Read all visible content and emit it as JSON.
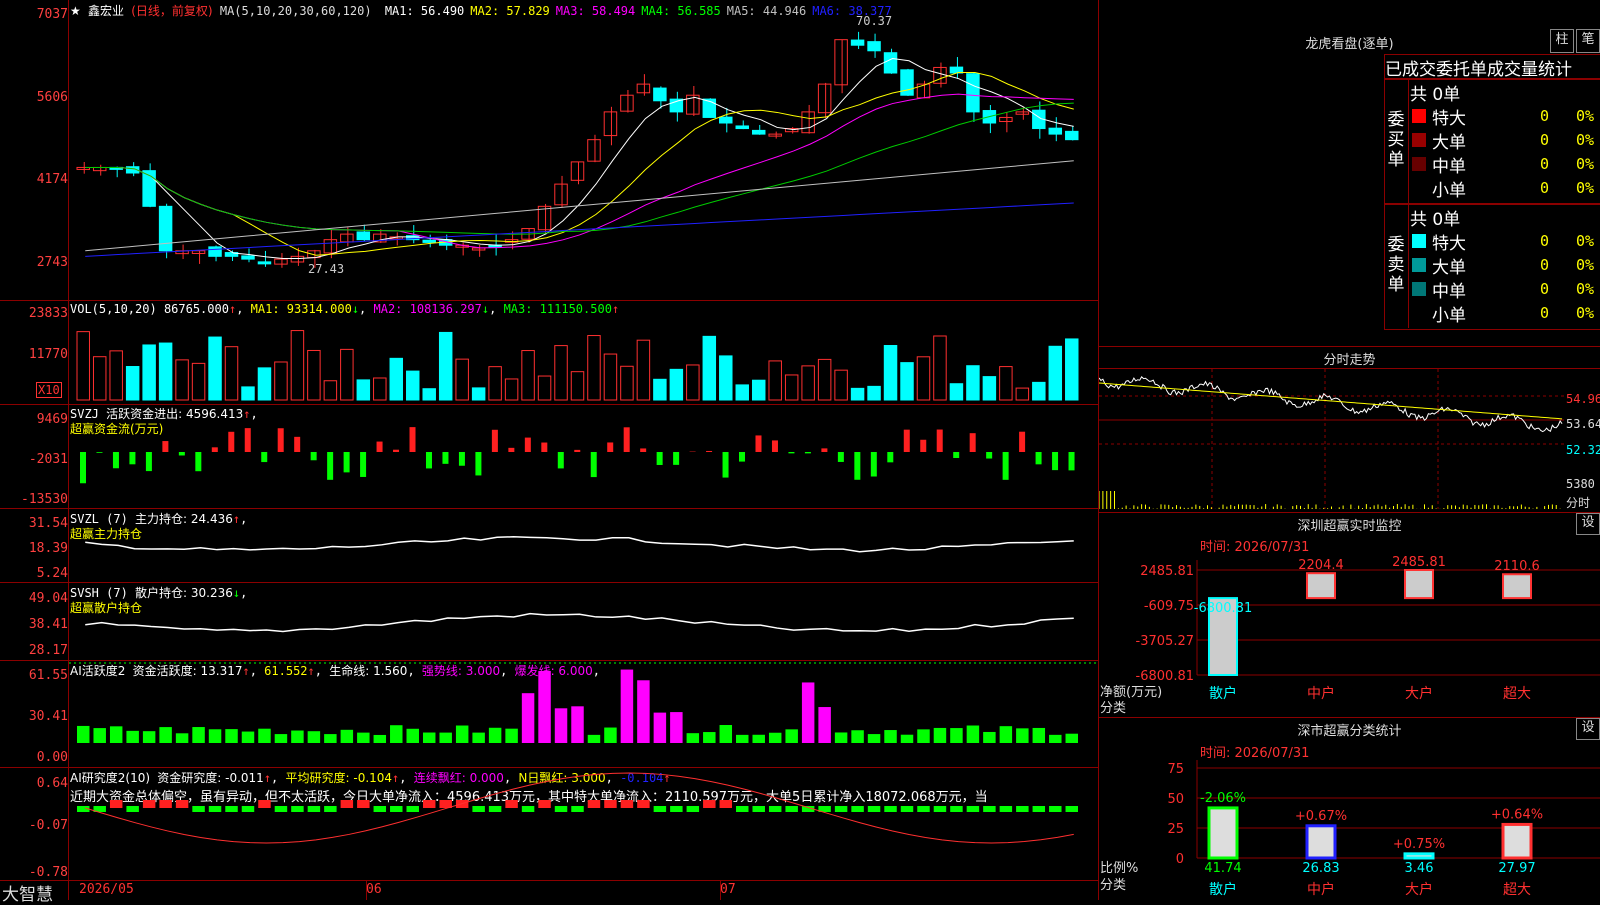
{
  "stock": {
    "name": "鑫宏业",
    "period": "(日线，前复权)",
    "ma_label": "MA(5,10,20,30,60,120)"
  },
  "ma_values": [
    {
      "label": "MA1:",
      "value": "56.490",
      "color": "#ffffff"
    },
    {
      "label": "MA2:",
      "value": "57.829",
      "color": "#ffff00"
    },
    {
      "label": "MA3:",
      "value": "58.494",
      "color": "#ff00ff"
    },
    {
      "label": "MA4:",
      "value": "56.585",
      "color": "#00ff00"
    },
    {
      "label": "MA5:",
      "value": "44.946",
      "color": "#c0c0c0"
    },
    {
      "label": "MA6:",
      "value": "38.377",
      "color": "#2020ff"
    }
  ],
  "main_yaxis": [
    "7037",
    "5606",
    "4174",
    "2743"
  ],
  "price_high_label": "70.37",
  "price_low_label": "27.43",
  "vol": {
    "title": "VOL(5,10,20)",
    "value": "86765.000",
    "ma1": "MA1: 93314.000",
    "ma2": "MA2: 108136.297",
    "ma3": "MA3: 111150.500",
    "yaxis": [
      "23833",
      "11770"
    ],
    "unit": "X10"
  },
  "svzj": {
    "title": "SVZJ",
    "label": "活跃资金进出: 4596.413",
    "sub": "超赢资金流(万元)",
    "yaxis": [
      "9469",
      "-2031",
      "-13530"
    ]
  },
  "svzl": {
    "title": "SVZL (7)",
    "label": "主力持仓: 24.436",
    "sub": "超赢主力持仓",
    "yaxis": [
      "31.54",
      "18.39",
      "5.24"
    ]
  },
  "svsh": {
    "title": "SVSH (7)",
    "label": "散户持仓: 30.236",
    "sub": "超赢散户持仓",
    "yaxis": [
      "49.04",
      "38.41",
      "28.17"
    ]
  },
  "ai1": {
    "title": "AI活跃度2",
    "label": "资金活跃度: 13.317",
    "v2": "61.552",
    "v3": "生命线: 1.560",
    "v4": "强势线: 3.000",
    "v5": "爆发线: 6.000",
    "yaxis": [
      "61.55",
      "30.41",
      "0.00"
    ]
  },
  "ai2": {
    "title": "AI研究度2(10)",
    "label": "资金研究度: -0.011",
    "v2": "平均研究度: -0.104",
    "v3": "连续飘红: 0.000",
    "v4": "N日飘红: 3.000",
    "v5": "-0.104",
    "yaxis": [
      "0.64",
      "-0.07",
      "-0.78"
    ],
    "summary": "近期大资金总体偏空，虽有异动，但不太活跃，今日大单净流入：4596.413万元，其中特大单净流入：2110.597万元，大单5日累计净入18072.068万元，当"
  },
  "xaxis": {
    "brand": "大智慧",
    "labels": [
      "2026/05",
      "06",
      "07"
    ]
  },
  "lhb": {
    "title": "龙虎看盘(逐单)",
    "btn1": "柱",
    "btn2": "笔",
    "subtitle": "已成交委托单成交量统计",
    "buy_label": "委买单",
    "sell_label": "委卖单",
    "total_buy": "共 0单",
    "total_sell": "共 0单",
    "buy_rows": [
      {
        "name": "特大",
        "count": "0",
        "pct": "0%",
        "color": "#ff0000"
      },
      {
        "name": "大单",
        "count": "0",
        "pct": "0%",
        "color": "#990000"
      },
      {
        "name": "中单",
        "count": "0",
        "pct": "0%",
        "color": "#660000"
      },
      {
        "name": "小单",
        "count": "0",
        "pct": "0%",
        "color": "#000000"
      }
    ],
    "sell_rows": [
      {
        "name": "特大",
        "count": "0",
        "pct": "0%",
        "color": "#00ffff"
      },
      {
        "name": "大单",
        "count": "0",
        "pct": "0%",
        "color": "#009999"
      },
      {
        "name": "中单",
        "count": "0",
        "pct": "0%",
        "color": "#007777"
      },
      {
        "name": "小单",
        "count": "0",
        "pct": "0%",
        "color": "#000000"
      }
    ]
  },
  "fenshi": {
    "title": "分时走势",
    "prices": [
      "54.96",
      "53.64",
      "52.32"
    ],
    "vol": "5380",
    "vol_unit": "分时"
  },
  "monitor": {
    "title": "深圳超赢实时监控",
    "btn": "设",
    "time": "时间: 2026/07/31",
    "yaxis": [
      "2485.81",
      "-609.75",
      "-3705.27",
      "-6800.81"
    ],
    "ylab1": "净额(万元)",
    "ylab2": "分类",
    "bars": [
      {
        "cat": "散户",
        "value": "-6800.81"
      },
      {
        "cat": "中户",
        "value": "2204.4"
      },
      {
        "cat": "大户",
        "value": "2485.81"
      },
      {
        "cat": "超大",
        "value": "2110.6"
      }
    ]
  },
  "classify": {
    "title": "深市超赢分类统计",
    "btn": "设",
    "time": "时间: 2026/07/31",
    "yaxis": [
      "75",
      "50",
      "25",
      "0"
    ],
    "ylab1": "比例%",
    "ylab2": "分类",
    "bars": [
      {
        "cat": "散户",
        "pct": "41.74",
        "delta": "-2.06%"
      },
      {
        "cat": "中户",
        "pct": "26.83",
        "delta": "+0.67%"
      },
      {
        "cat": "大户",
        "pct": "3.46",
        "delta": "+0.75%"
      },
      {
        "cat": "超大",
        "pct": "27.97",
        "delta": "+0.64%"
      }
    ]
  },
  "chart_data": {
    "type": "bar",
    "monitor_net_amount": {
      "categories": [
        "散户",
        "中户",
        "大户",
        "超大"
      ],
      "values": [
        -6800.81,
        2204.4,
        2485.81,
        2110.6
      ]
    },
    "classify_ratio": {
      "categories": [
        "散户",
        "中户",
        "大户",
        "超大"
      ],
      "values": [
        41.74,
        26.83,
        3.46,
        27.97
      ],
      "ylim": [
        0,
        75
      ]
    }
  }
}
